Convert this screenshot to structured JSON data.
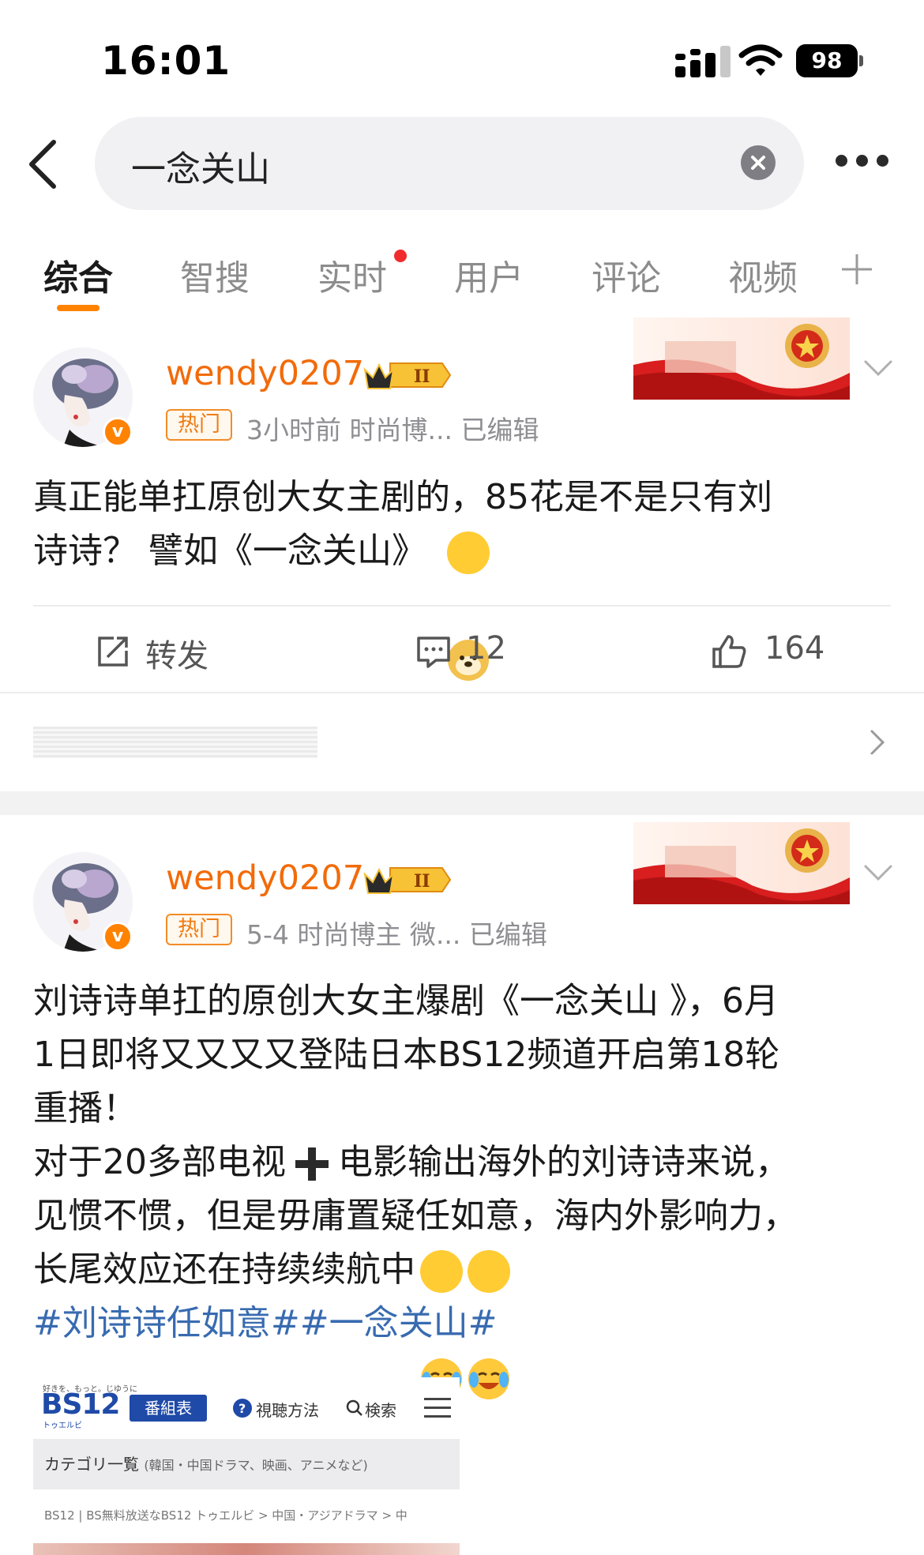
{
  "status_bar": {
    "time": "16:01",
    "battery": "98"
  },
  "search": {
    "query": "一念关山"
  },
  "tabs": [
    {
      "label": "综合",
      "active": true
    },
    {
      "label": "智搜"
    },
    {
      "label": "实时",
      "has_dot": true
    },
    {
      "label": "用户"
    },
    {
      "label": "评论"
    },
    {
      "label": "视频"
    }
  ],
  "colors": {
    "accent": "#ff8200",
    "username": "#f26b0a",
    "hashtag": "#386bb0"
  },
  "posts": [
    {
      "username": "wendy0207",
      "hot_tag": "热门",
      "meta": "3小时前  时尚博...  已编辑",
      "text_lines": [
        "真正能单扛原创大女主剧的，85花是不是只有刘",
        "诗诗？ 譬如《一念关山》"
      ],
      "repost_label": "转发",
      "comments": "12",
      "likes": "164"
    },
    {
      "username": "wendy0207",
      "hot_tag": "热门",
      "meta": "5-4  时尚博主 微...  已编辑",
      "text_lines": [
        "刘诗诗单扛的原创大女主爆剧《一念关山 》，6月",
        "1日即将又又又又登陆日本BS12频道开启第18轮",
        "重播！",
        "对于20多部电视",
        "电影输出海外的刘诗诗来说，",
        "见惯不惯，但是毋庸置疑任如意，海内外影响力，",
        "长尾效应还在持续续航中"
      ],
      "hashtags": "#刘诗诗任如意##一念关山#"
    }
  ],
  "embed": {
    "tagline": "好きを、もっと。じゆうに",
    "logo": "BS12",
    "logo_sub": "トゥエルビ",
    "schedule_button": "番組表",
    "how_to_watch": "視聴方法",
    "search": "検索",
    "category": "カテゴリ一覧",
    "category_note": "(韓国・中国ドラマ、映画、アニメなど)",
    "breadcrumb": "BS12 | BS無料放送なBS12 トゥエルビ > 中国・アジアドラマ > 中"
  }
}
